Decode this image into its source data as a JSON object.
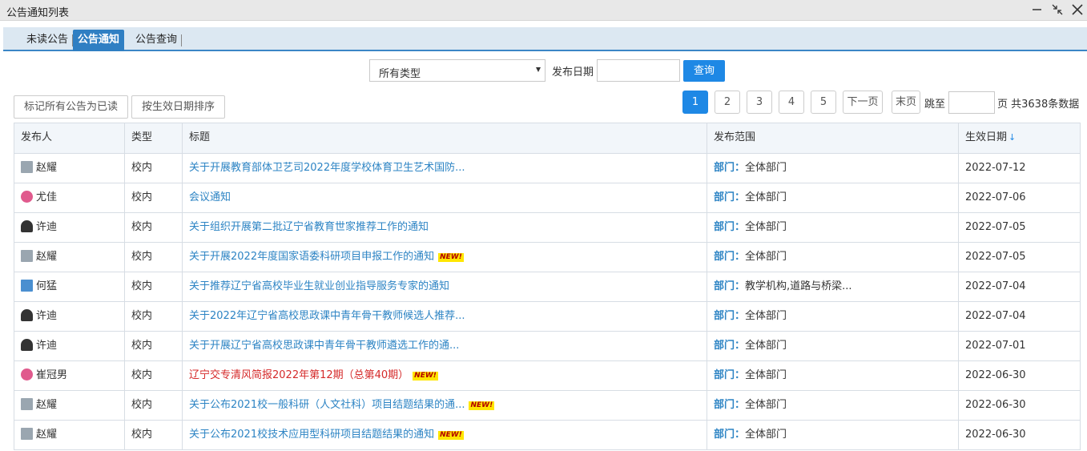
{
  "window": {
    "title": "公告通知列表"
  },
  "tabs": [
    {
      "label": "未读公告",
      "active": false
    },
    {
      "label": "公告通知",
      "active": true
    },
    {
      "label": "公告查询",
      "active": false
    }
  ],
  "filters": {
    "type_select_value": "所有类型",
    "date_label": "发布日期",
    "date_value": "",
    "query_label": "查询"
  },
  "actions": {
    "mark_all_read": "标记所有公告为已读",
    "sort_by_date": "按生效日期排序"
  },
  "pagination": {
    "pages": [
      "1",
      "2",
      "3",
      "4",
      "5"
    ],
    "current": "1",
    "next_label": "下一页",
    "last_label": "末页",
    "jump_label": "跳至",
    "jump_value": "",
    "total_label": "页 共3638条数据"
  },
  "table": {
    "columns": [
      "发布人",
      "类型",
      "标题",
      "发布范围",
      "生效日期"
    ],
    "sort_indicator": "↓",
    "scope_prefix": "部门：",
    "new_badge": "NEW!",
    "rows": [
      {
        "publisher": "赵耀",
        "avatar": "male-photo",
        "type": "校内",
        "title": "关于开展教育部体卫艺司2022年度学校体育卫生艺术国防...",
        "is_new": false,
        "highlight": false,
        "scope": "全体部门",
        "date": "2022-07-12"
      },
      {
        "publisher": "尤佳",
        "avatar": "female-cartoon",
        "type": "校内",
        "title": "会议通知",
        "is_new": false,
        "highlight": false,
        "scope": "全体部门",
        "date": "2022-07-06"
      },
      {
        "publisher": "许迪",
        "avatar": "female-silhouette",
        "type": "校内",
        "title": "关于组织开展第二批辽宁省教育世家推荐工作的通知",
        "is_new": false,
        "highlight": false,
        "scope": "全体部门",
        "date": "2022-07-05"
      },
      {
        "publisher": "赵耀",
        "avatar": "male-photo",
        "type": "校内",
        "title": "关于开展2022年度国家语委科研项目申报工作的通知",
        "is_new": true,
        "highlight": false,
        "scope": "全体部门",
        "date": "2022-07-05"
      },
      {
        "publisher": "何猛",
        "avatar": "male-photo-blue",
        "type": "校内",
        "title": "关于推荐辽宁省高校毕业生就业创业指导服务专家的通知",
        "is_new": false,
        "highlight": false,
        "scope": "教学机构,道路与桥梁...",
        "date": "2022-07-04"
      },
      {
        "publisher": "许迪",
        "avatar": "female-silhouette",
        "type": "校内",
        "title": "关于2022年辽宁省高校思政课中青年骨干教师候选人推荐...",
        "is_new": false,
        "highlight": false,
        "scope": "全体部门",
        "date": "2022-07-04"
      },
      {
        "publisher": "许迪",
        "avatar": "female-silhouette",
        "type": "校内",
        "title": "关于开展辽宁省高校思政课中青年骨干教师遴选工作的通...",
        "is_new": false,
        "highlight": false,
        "scope": "全体部门",
        "date": "2022-07-01"
      },
      {
        "publisher": "崔冠男",
        "avatar": "female-cartoon",
        "type": "校内",
        "title": "辽宁交专清风简报2022年第12期（总第40期）",
        "is_new": true,
        "highlight": true,
        "scope": "全体部门",
        "date": "2022-06-30"
      },
      {
        "publisher": "赵耀",
        "avatar": "male-photo",
        "type": "校内",
        "title": "关于公布2021校一般科研（人文社科）项目结题结果的通...",
        "is_new": true,
        "highlight": false,
        "scope": "全体部门",
        "date": "2022-06-30"
      },
      {
        "publisher": "赵耀",
        "avatar": "male-photo",
        "type": "校内",
        "title": "关于公布2021校技术应用型科研项目结题结果的通知",
        "is_new": true,
        "highlight": false,
        "scope": "全体部门",
        "date": "2022-06-30"
      }
    ]
  },
  "colors": {
    "accent": "#1e88e5",
    "link": "#2d84c4",
    "highlight_title": "#d52a2a",
    "tab_active": "#2f7fc3",
    "tabbar_bg": "#dce8f2"
  }
}
